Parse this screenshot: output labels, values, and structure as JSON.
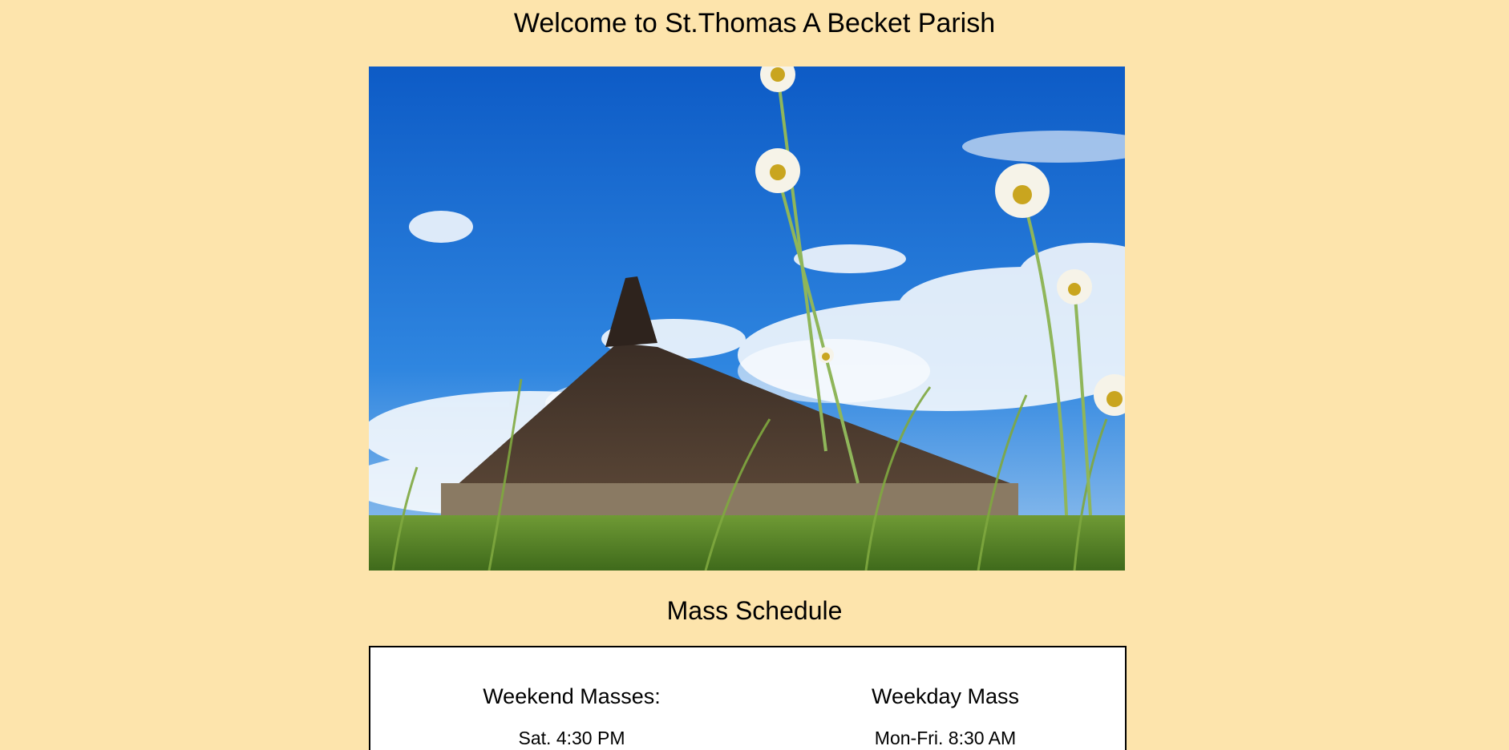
{
  "header": {
    "title": "Welcome to St.Thomas A Becket Parish"
  },
  "hero": {
    "description": ""
  },
  "mass_schedule": {
    "title": "Mass Schedule",
    "weekend": {
      "heading": "Weekend Masses:",
      "times": [
        "Sat. 4:30 PM"
      ]
    },
    "weekday": {
      "heading": "Weekday Mass",
      "times": [
        "Mon-Fri. 8:30 AM"
      ]
    }
  },
  "colors": {
    "background": "#fde4ac",
    "box": "#ffffff",
    "sky": "#1f6fd0",
    "roof": "#4a3a30",
    "grass": "#5c8a2a"
  }
}
